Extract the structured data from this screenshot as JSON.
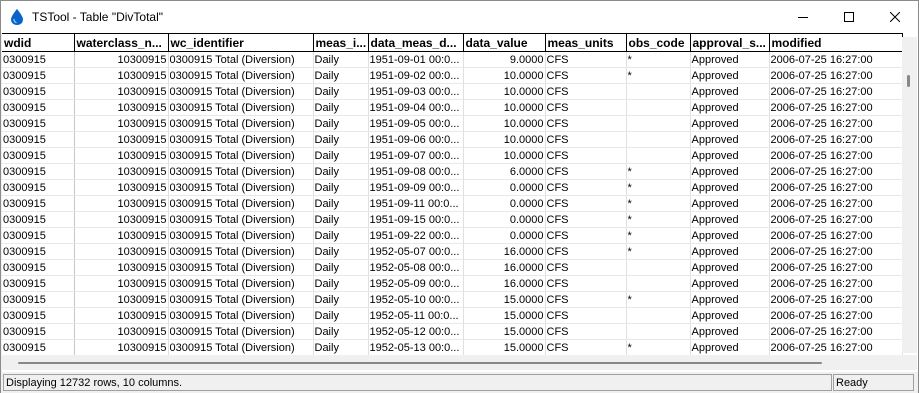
{
  "window": {
    "title": "TSTool - Table \"DivTotal\""
  },
  "columns": [
    "wdid",
    "waterclass_n...",
    "wc_identifier",
    "meas_i...",
    "data_meas_d...",
    "data_value",
    "meas_units",
    "obs_code",
    "approval_s...",
    "modified"
  ],
  "rows": [
    [
      "0300915",
      "10300915",
      "0300915 Total (Diversion)",
      "Daily",
      "1951-09-01 00:0...",
      "9.0000",
      "CFS",
      "*",
      "Approved",
      "2006-07-25 16:27:00"
    ],
    [
      "0300915",
      "10300915",
      "0300915 Total (Diversion)",
      "Daily",
      "1951-09-02 00:0...",
      "10.0000",
      "CFS",
      "*",
      "Approved",
      "2006-07-25 16:27:00"
    ],
    [
      "0300915",
      "10300915",
      "0300915 Total (Diversion)",
      "Daily",
      "1951-09-03 00:0...",
      "10.0000",
      "CFS",
      "",
      "Approved",
      "2006-07-25 16:27:00"
    ],
    [
      "0300915",
      "10300915",
      "0300915 Total (Diversion)",
      "Daily",
      "1951-09-04 00:0...",
      "10.0000",
      "CFS",
      "",
      "Approved",
      "2006-07-25 16:27:00"
    ],
    [
      "0300915",
      "10300915",
      "0300915 Total (Diversion)",
      "Daily",
      "1951-09-05 00:0...",
      "10.0000",
      "CFS",
      "",
      "Approved",
      "2006-07-25 16:27:00"
    ],
    [
      "0300915",
      "10300915",
      "0300915 Total (Diversion)",
      "Daily",
      "1951-09-06 00:0...",
      "10.0000",
      "CFS",
      "",
      "Approved",
      "2006-07-25 16:27:00"
    ],
    [
      "0300915",
      "10300915",
      "0300915 Total (Diversion)",
      "Daily",
      "1951-09-07 00:0...",
      "10.0000",
      "CFS",
      "",
      "Approved",
      "2006-07-25 16:27:00"
    ],
    [
      "0300915",
      "10300915",
      "0300915 Total (Diversion)",
      "Daily",
      "1951-09-08 00:0...",
      "6.0000",
      "CFS",
      "*",
      "Approved",
      "2006-07-25 16:27:00"
    ],
    [
      "0300915",
      "10300915",
      "0300915 Total (Diversion)",
      "Daily",
      "1951-09-09 00:0...",
      "0.0000",
      "CFS",
      "*",
      "Approved",
      "2006-07-25 16:27:00"
    ],
    [
      "0300915",
      "10300915",
      "0300915 Total (Diversion)",
      "Daily",
      "1951-09-11 00:0...",
      "0.0000",
      "CFS",
      "*",
      "Approved",
      "2006-07-25 16:27:00"
    ],
    [
      "0300915",
      "10300915",
      "0300915 Total (Diversion)",
      "Daily",
      "1951-09-15 00:0...",
      "0.0000",
      "CFS",
      "*",
      "Approved",
      "2006-07-25 16:27:00"
    ],
    [
      "0300915",
      "10300915",
      "0300915 Total (Diversion)",
      "Daily",
      "1951-09-22 00:0...",
      "0.0000",
      "CFS",
      "*",
      "Approved",
      "2006-07-25 16:27:00"
    ],
    [
      "0300915",
      "10300915",
      "0300915 Total (Diversion)",
      "Daily",
      "1952-05-07 00:0...",
      "16.0000",
      "CFS",
      "*",
      "Approved",
      "2006-07-25 16:27:00"
    ],
    [
      "0300915",
      "10300915",
      "0300915 Total (Diversion)",
      "Daily",
      "1952-05-08 00:0...",
      "16.0000",
      "CFS",
      "",
      "Approved",
      "2006-07-25 16:27:00"
    ],
    [
      "0300915",
      "10300915",
      "0300915 Total (Diversion)",
      "Daily",
      "1952-05-09 00:0...",
      "16.0000",
      "CFS",
      "",
      "Approved",
      "2006-07-25 16:27:00"
    ],
    [
      "0300915",
      "10300915",
      "0300915 Total (Diversion)",
      "Daily",
      "1952-05-10 00:0...",
      "15.0000",
      "CFS",
      "*",
      "Approved",
      "2006-07-25 16:27:00"
    ],
    [
      "0300915",
      "10300915",
      "0300915 Total (Diversion)",
      "Daily",
      "1952-05-11 00:0...",
      "15.0000",
      "CFS",
      "",
      "Approved",
      "2006-07-25 16:27:00"
    ],
    [
      "0300915",
      "10300915",
      "0300915 Total (Diversion)",
      "Daily",
      "1952-05-12 00:0...",
      "15.0000",
      "CFS",
      "",
      "Approved",
      "2006-07-25 16:27:00"
    ],
    [
      "0300915",
      "10300915",
      "0300915 Total (Diversion)",
      "Daily",
      "1952-05-13 00:0...",
      "15.0000",
      "CFS",
      "*",
      "Approved",
      "2006-07-25 16:27:00"
    ]
  ],
  "status": {
    "message": "Displaying 12732 rows, 10 columns.",
    "state": "Ready"
  },
  "colors": {
    "accent": "#0a64c8",
    "grid_line": "#e0e0e0"
  },
  "icons": {
    "app": "water-drop-icon",
    "minimize": "minimize-icon",
    "maximize": "maximize-icon",
    "close": "close-icon"
  }
}
